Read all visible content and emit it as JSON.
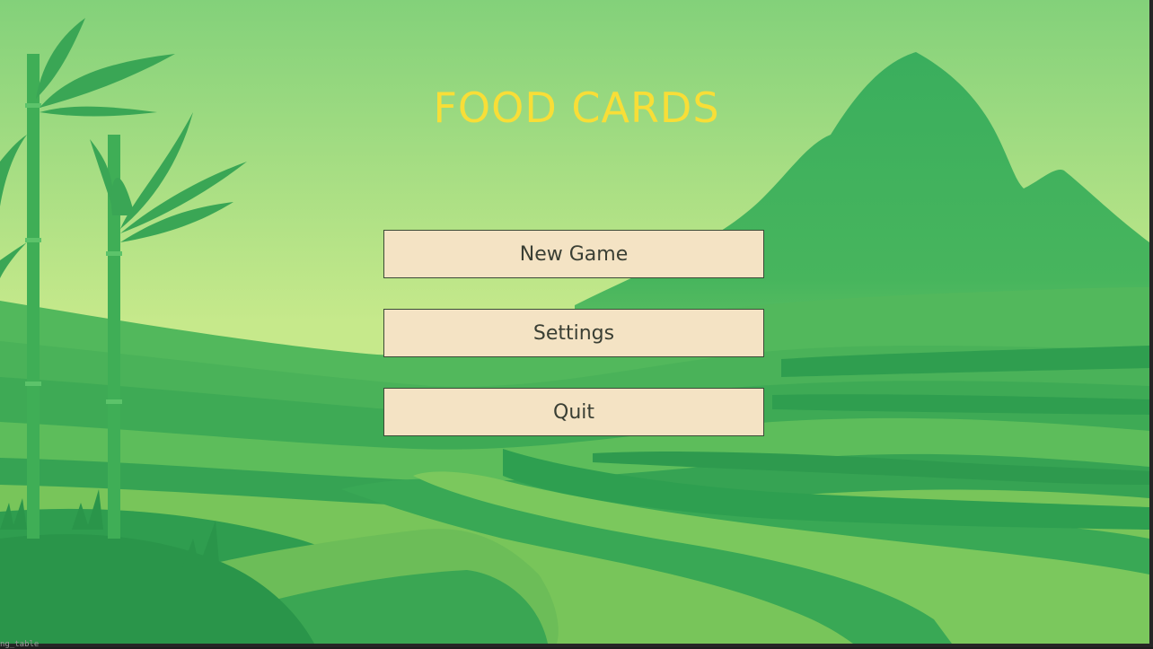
{
  "game": {
    "title": "FOOD CARDS"
  },
  "menu": {
    "buttons": [
      {
        "label": "New Game"
      },
      {
        "label": "Settings"
      },
      {
        "label": "Quit"
      }
    ]
  },
  "footer": {
    "text": "ng_table"
  },
  "colors": {
    "title": "#f8de37",
    "button_bg": "#f4e3c4",
    "button_text": "#3a3f34",
    "sky_top": "#7fd07a",
    "sky_bottom": "#c8e98a",
    "hill_dark": "#2fa95a",
    "field_light": "#7fc85a"
  }
}
